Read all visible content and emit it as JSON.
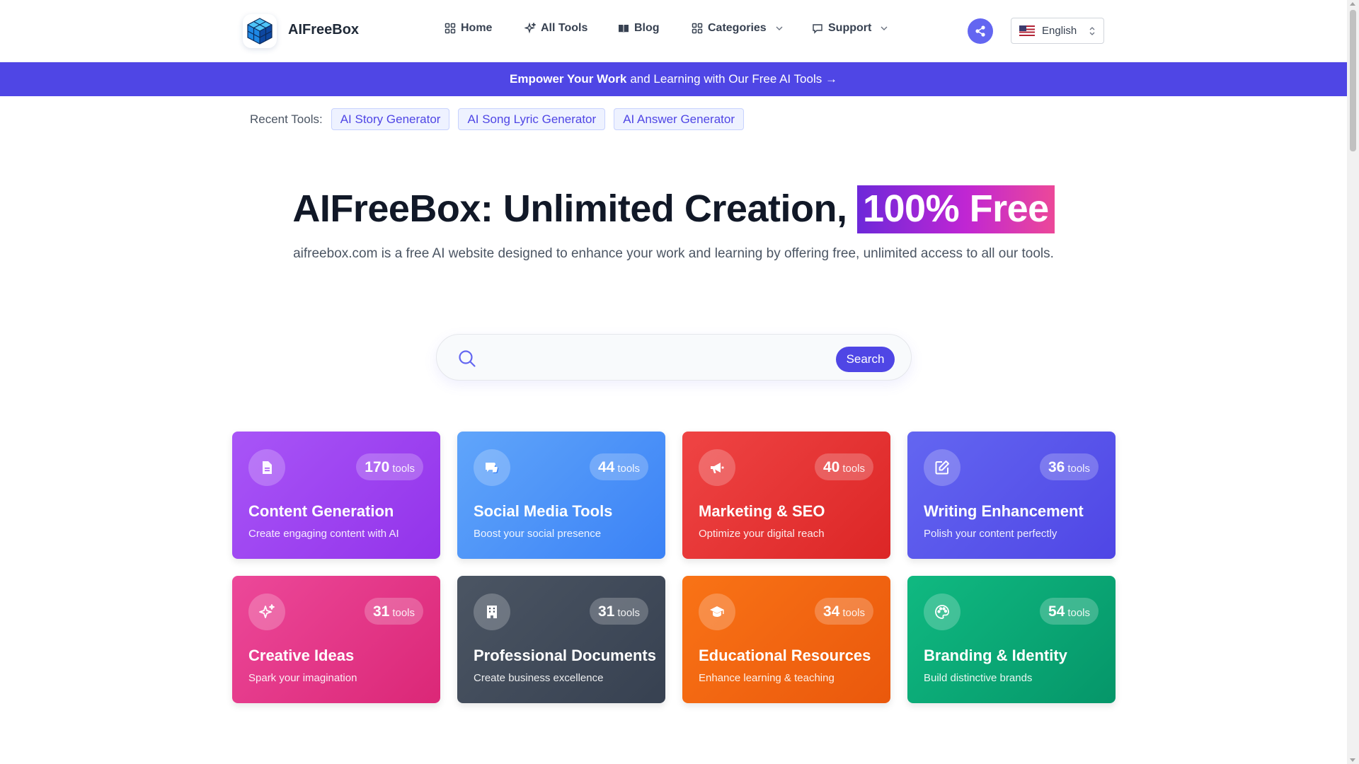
{
  "header": {
    "brand": "AIFreeBox",
    "nav": [
      {
        "label": "Home",
        "icon": "grid-icon"
      },
      {
        "label": "All Tools",
        "icon": "sparkle-icon"
      },
      {
        "label": "Blog",
        "icon": "book-icon"
      },
      {
        "label": "Categories",
        "icon": "grid-icon",
        "dropdown": true
      },
      {
        "label": "Support",
        "icon": "chat-icon",
        "dropdown": true
      }
    ],
    "language": "English"
  },
  "banner": {
    "bold": "Empower Your Work",
    "rest": "and Learning with Our Free AI Tools →"
  },
  "recent": {
    "label": "Recent Tools:",
    "tools": [
      "AI Story Generator",
      "AI Song Lyric Generator",
      "AI Answer Generator"
    ]
  },
  "hero": {
    "title": "AIFreeBox: Unlimited Creation,",
    "highlight": "100% Free",
    "subtitle": "aifreebox.com is a free AI website designed to enhance your work and learning by offering free, unlimited access to all our tools."
  },
  "search": {
    "placeholder": "",
    "button": "Search"
  },
  "categories": [
    {
      "count": "170",
      "unit": "tools",
      "title": "Content Generation",
      "desc": "Create engaging content with AI",
      "icon": "document-icon",
      "color": "#9333ea"
    },
    {
      "count": "44",
      "unit": "tools",
      "title": "Social Media Tools",
      "desc": "Boost your social presence",
      "icon": "thumbs-up-icon",
      "color": "#3b82f6"
    },
    {
      "count": "40",
      "unit": "tools",
      "title": "Marketing & SEO",
      "desc": "Optimize your digital reach",
      "icon": "megaphone-icon",
      "color": "#dc2626"
    },
    {
      "count": "36",
      "unit": "tools",
      "title": "Writing Enhancement",
      "desc": "Polish your content perfectly",
      "icon": "edit-icon",
      "color": "#4f46e5"
    },
    {
      "count": "31",
      "unit": "tools",
      "title": "Creative Ideas",
      "desc": "Spark your imagination",
      "icon": "sparkle-icon",
      "color": "#db2777"
    },
    {
      "count": "31",
      "unit": "tools",
      "title": "Professional Documents",
      "desc": "Create business excellence",
      "icon": "building-icon",
      "color": "#374151"
    },
    {
      "count": "34",
      "unit": "tools",
      "title": "Educational Resources",
      "desc": "Enhance learning & teaching",
      "icon": "graduation-cap-icon",
      "color": "#ea580c"
    },
    {
      "count": "54",
      "unit": "tools",
      "title": "Branding & Identity",
      "desc": "Build distinctive brands",
      "icon": "palette-icon",
      "color": "#059669"
    }
  ]
}
